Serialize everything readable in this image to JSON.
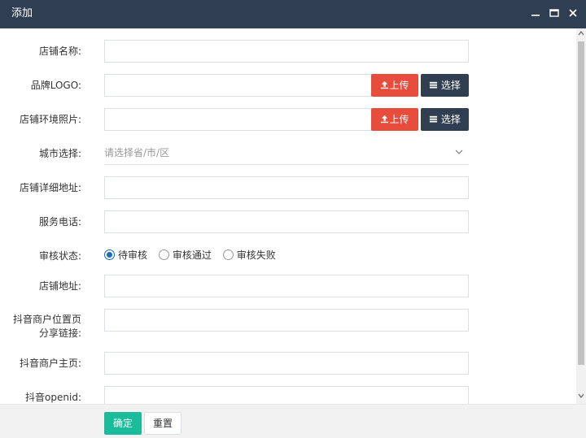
{
  "dialog": {
    "title": "添加"
  },
  "form": {
    "store_name_label": "店铺名称:",
    "brand_logo_label": "品牌LOGO:",
    "store_photo_label": "店铺环境照片:",
    "city_label": "城市选择:",
    "city_placeholder": "请选择省/市/区",
    "address_detail_label": "店铺详细地址:",
    "phone_label": "服务电话:",
    "status_label": "审核状态:",
    "status_options": [
      "待审核",
      "审核通过",
      "审核失败"
    ],
    "status_selected": "待审核",
    "store_address_label": "店铺地址:",
    "douyin_share_label_line1": "抖音商户位置页",
    "douyin_share_label_line2": "分享链接:",
    "douyin_home_label": "抖音商户主页:",
    "douyin_openid_label": "抖音openid:",
    "upload_label": "上传",
    "select_label": "选择"
  },
  "footer": {
    "ok_label": "确定",
    "reset_label": "重置"
  },
  "colors": {
    "titlebar": "#2f3e50",
    "upload": "#e74c3c",
    "select": "#2f3e50",
    "ok": "#1abc9c",
    "radio": "#1e6bb8"
  },
  "icons": {
    "upload": "upload-icon",
    "select": "list-icon",
    "minimize": "minimize-icon",
    "maximize": "restore-icon",
    "close": "close-icon"
  }
}
